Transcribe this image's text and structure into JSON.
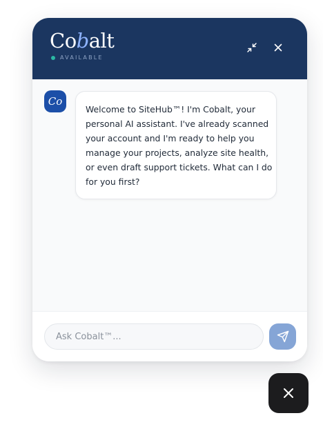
{
  "header": {
    "logo_start": "Co",
    "logo_accent": "b",
    "logo_end": "alt",
    "status": "AVAILABLE"
  },
  "icons": {
    "minimize": "minimize-icon",
    "close": "close-icon",
    "send": "send-icon",
    "launcher": "close-icon"
  },
  "messages": [
    {
      "sender": "assistant",
      "avatar_text": "Co",
      "text": "Welcome to SiteHub™! I'm Cobalt, your personal AI assistant. I've already scanned your account and I'm ready to help you manage your projects, analyze site health, or even draft support tickets. What can I do for you first?"
    }
  ],
  "composer": {
    "placeholder": "Ask Cobalt™...",
    "value": ""
  },
  "colors": {
    "header": "#1b3660",
    "status_dot": "#2bb8a3",
    "avatar": "#1c4fa8",
    "send_button": "#85a5d6",
    "launcher": "#1c1c1e",
    "logo_accent": "#8fb4ff"
  }
}
